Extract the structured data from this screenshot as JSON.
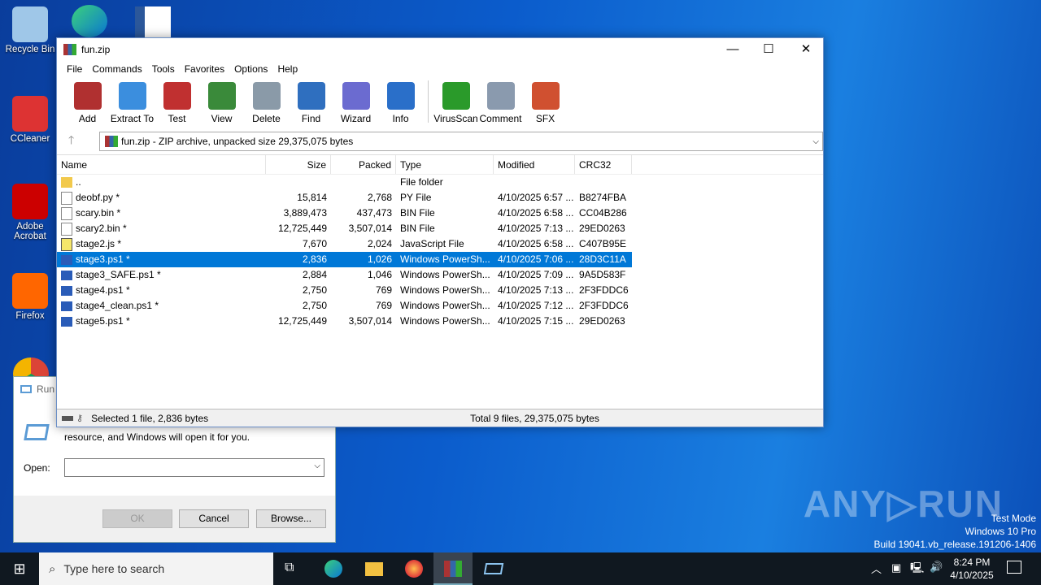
{
  "desktop": {
    "icons": [
      {
        "label": "Recycle Bin",
        "color": "#9fc7e8"
      },
      {
        "label": "CCleaner",
        "color": "#d33"
      },
      {
        "label": "Adobe Acrobat",
        "color": "#c00"
      },
      {
        "label": "Firefox",
        "color": "#f60"
      }
    ],
    "watermark": {
      "logo": "ANY RUN",
      "line1": "Test Mode",
      "line2": "Windows 10 Pro",
      "line3": "Build 19041.vb_release.191206-1406"
    }
  },
  "window": {
    "title": "fun.zip",
    "menu": [
      "File",
      "Commands",
      "Tools",
      "Favorites",
      "Options",
      "Help"
    ],
    "toolbar": [
      {
        "label": "Add",
        "icon": "add-icon",
        "color": "#b03030"
      },
      {
        "label": "Extract To",
        "icon": "folder-icon",
        "color": "#3b8ede"
      },
      {
        "label": "Test",
        "icon": "checklist-icon",
        "color": "#c03030"
      },
      {
        "label": "View",
        "icon": "book-icon",
        "color": "#3a8a3a"
      },
      {
        "label": "Delete",
        "icon": "trash-icon",
        "color": "#8a9aa8"
      },
      {
        "label": "Find",
        "icon": "magnifier-icon",
        "color": "#2f6fbf"
      },
      {
        "label": "Wizard",
        "icon": "wand-icon",
        "color": "#6b6bd0"
      },
      {
        "label": "Info",
        "icon": "info-icon",
        "color": "#2a6fc9"
      },
      {
        "label": "VirusScan",
        "icon": "bug-icon",
        "color": "#2a9a2a"
      },
      {
        "label": "Comment",
        "icon": "comment-icon",
        "color": "#8a9aae"
      },
      {
        "label": "SFX",
        "icon": "sfx-icon",
        "color": "#d05030"
      }
    ],
    "address": "fun.zip - ZIP archive, unpacked size 29,375,075 bytes",
    "columns": [
      "Name",
      "Size",
      "Packed",
      "Type",
      "Modified",
      "CRC32"
    ],
    "rows": [
      {
        "name": "..",
        "size": "",
        "packed": "",
        "type": "File folder",
        "modified": "",
        "crc": "",
        "icon": "folder"
      },
      {
        "name": "deobf.py *",
        "size": "15,814",
        "packed": "2,768",
        "type": "PY File",
        "modified": "4/10/2025 6:57 ...",
        "crc": "B8274FBA",
        "icon": "file"
      },
      {
        "name": "scary.bin *",
        "size": "3,889,473",
        "packed": "437,473",
        "type": "BIN File",
        "modified": "4/10/2025 6:58 ...",
        "crc": "CC04B286",
        "icon": "file"
      },
      {
        "name": "scary2.bin *",
        "size": "12,725,449",
        "packed": "3,507,014",
        "type": "BIN File",
        "modified": "4/10/2025 7:13 ...",
        "crc": "29ED0263",
        "icon": "file"
      },
      {
        "name": "stage2.js *",
        "size": "7,670",
        "packed": "2,024",
        "type": "JavaScript File",
        "modified": "4/10/2025 6:58 ...",
        "crc": "C407B95E",
        "icon": "js"
      },
      {
        "name": "stage3.ps1 *",
        "size": "2,836",
        "packed": "1,026",
        "type": "Windows PowerSh...",
        "modified": "4/10/2025 7:06 ...",
        "crc": "28D3C11A",
        "icon": "ps",
        "selected": true
      },
      {
        "name": "stage3_SAFE.ps1 *",
        "size": "2,884",
        "packed": "1,046",
        "type": "Windows PowerSh...",
        "modified": "4/10/2025 7:09 ...",
        "crc": "9A5D583F",
        "icon": "ps"
      },
      {
        "name": "stage4.ps1 *",
        "size": "2,750",
        "packed": "769",
        "type": "Windows PowerSh...",
        "modified": "4/10/2025 7:13 ...",
        "crc": "2F3FDDC6",
        "icon": "ps"
      },
      {
        "name": "stage4_clean.ps1 *",
        "size": "2,750",
        "packed": "769",
        "type": "Windows PowerSh...",
        "modified": "4/10/2025 7:12 ...",
        "crc": "2F3FDDC6",
        "icon": "ps"
      },
      {
        "name": "stage5.ps1 *",
        "size": "12,725,449",
        "packed": "3,507,014",
        "type": "Windows PowerSh...",
        "modified": "4/10/2025 7:15 ...",
        "crc": "29ED0263",
        "icon": "ps"
      }
    ],
    "status_left": "Selected 1 file, 2,836 bytes",
    "status_right": "Total 9 files, 29,375,075 bytes"
  },
  "run": {
    "title": "Run",
    "desc": "resource, and Windows will open it for you.",
    "open_label": "Open:",
    "open_value": "",
    "ok": "OK",
    "cancel": "Cancel",
    "browse": "Browse..."
  },
  "taskbar": {
    "search_placeholder": "Type here to search",
    "time": "8:24 PM",
    "date": "4/10/2025"
  }
}
